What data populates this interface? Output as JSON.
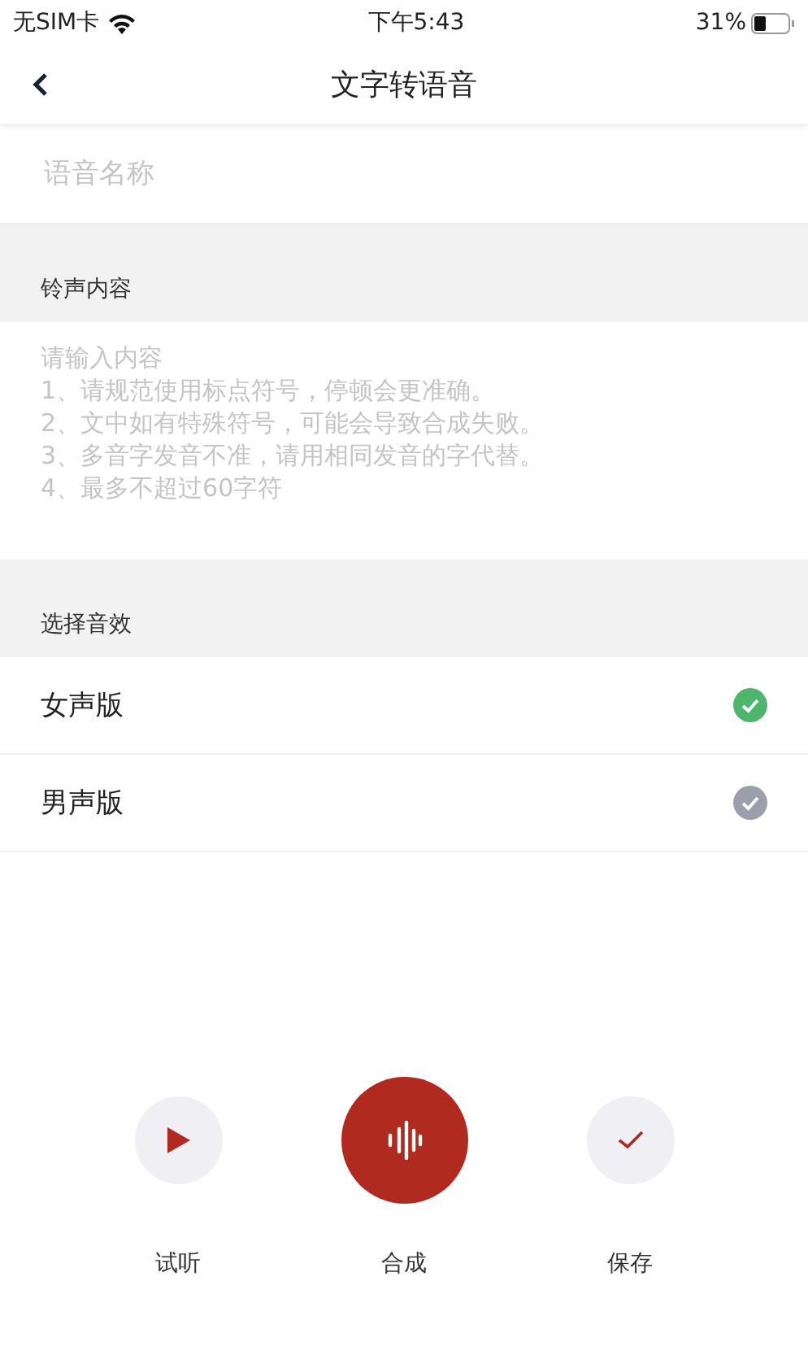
{
  "status_bar": {
    "carrier": "无SIM卡",
    "time": "下午5:43",
    "battery": "31%"
  },
  "nav": {
    "title": "文字转语音"
  },
  "name_field": {
    "placeholder": "语音名称"
  },
  "content_section": {
    "title": "铃声内容",
    "placeholder": "请输入内容\n1、请规范使用标点符号，停顿会更准确。\n2、文中如有特殊符号，可能会导致合成失败。\n3、多音字发音不准，请用相同发音的字代替。\n4、最多不超过60字符"
  },
  "effect_section": {
    "title": "选择音效",
    "options": [
      {
        "label": "女声版",
        "selected": true
      },
      {
        "label": "男声版",
        "selected": false
      }
    ]
  },
  "actions": [
    {
      "kind": "play",
      "label": "试听"
    },
    {
      "kind": "synth",
      "label": "合成"
    },
    {
      "kind": "save",
      "label": "保存"
    }
  ]
}
